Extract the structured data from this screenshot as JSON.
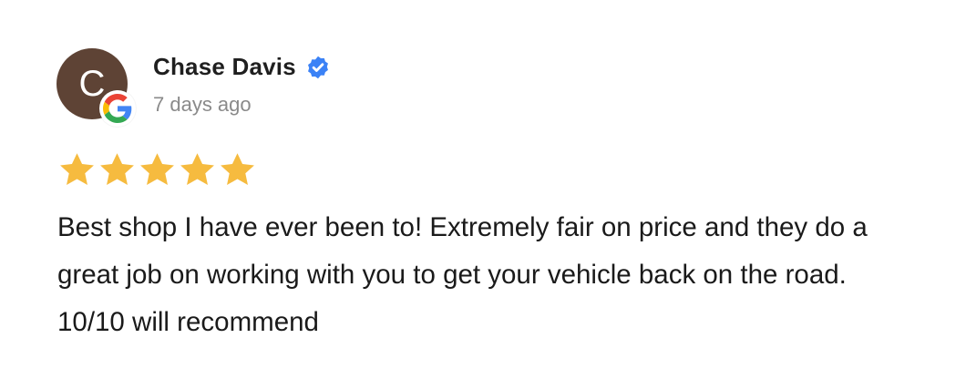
{
  "reviewer": {
    "initial": "C",
    "name": "Chase Davis",
    "time_ago": "7 days ago",
    "avatar_color": "#5e4335",
    "verified_icon": "verified-badge-icon",
    "source_icon": "google-g-icon"
  },
  "rating": {
    "value": 5,
    "max": 5,
    "star_color": "#f6bb3f"
  },
  "review": {
    "text": "Best shop I have ever been to! Extremely fair on price and they do a great job on working with you to get your vehicle back on the road. 10/10 will recommend"
  },
  "colors": {
    "verified_blue": "#3b82f6",
    "google_blue": "#4285F4",
    "google_red": "#EA4335",
    "google_yellow": "#FBBC05",
    "google_green": "#34A853"
  }
}
